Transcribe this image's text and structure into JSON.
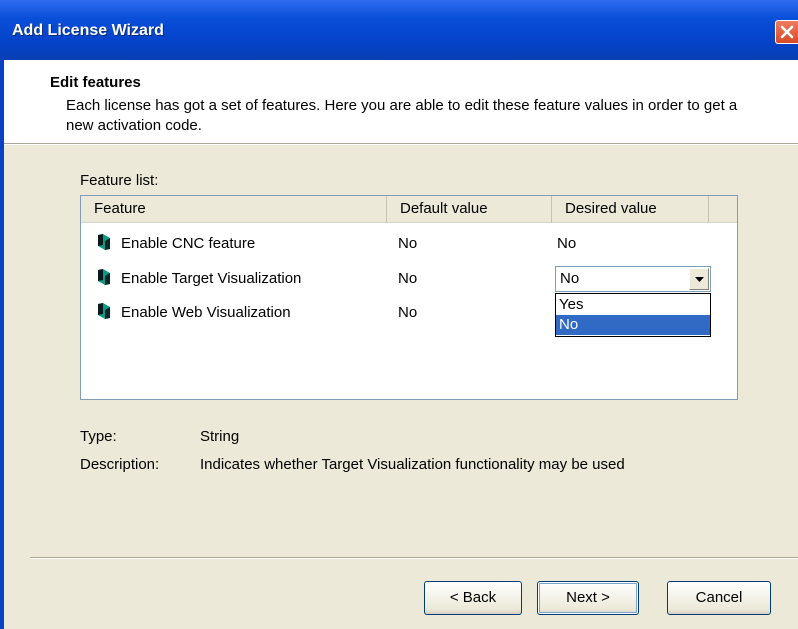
{
  "window": {
    "title": "Add License Wizard"
  },
  "header": {
    "title": "Edit features",
    "description": "Each license has got a set of features. Here you are able to edit these feature values in order to get a new activation code."
  },
  "feature_list": {
    "label": "Feature list:",
    "columns": [
      "Feature",
      "Default value",
      "Desired value"
    ],
    "rows": [
      {
        "feature": "Enable CNC feature",
        "default": "No",
        "desired": "No"
      },
      {
        "feature": "Enable Target Visualization",
        "default": "No",
        "desired": "No"
      },
      {
        "feature": "Enable Web Visualization",
        "default": "No",
        "desired": ""
      }
    ],
    "combo_value": "No",
    "dropdown_options": [
      "Yes",
      "No"
    ],
    "dropdown_selected": "No"
  },
  "details": {
    "type_label": "Type:",
    "type_value": "String",
    "description_label": "Description:",
    "description_value": "Indicates whether Target Visualization functionality may be used"
  },
  "buttons": {
    "back": "< Back",
    "next": "Next >",
    "cancel": "Cancel"
  },
  "icons": {
    "close": "close-icon",
    "feature": "feature-key-icon",
    "dropdown_arrow": "chevron-down-icon"
  },
  "colors": {
    "title_bar": "#0a4fd8",
    "selection": "#316ac5",
    "close": "#d84a26"
  }
}
